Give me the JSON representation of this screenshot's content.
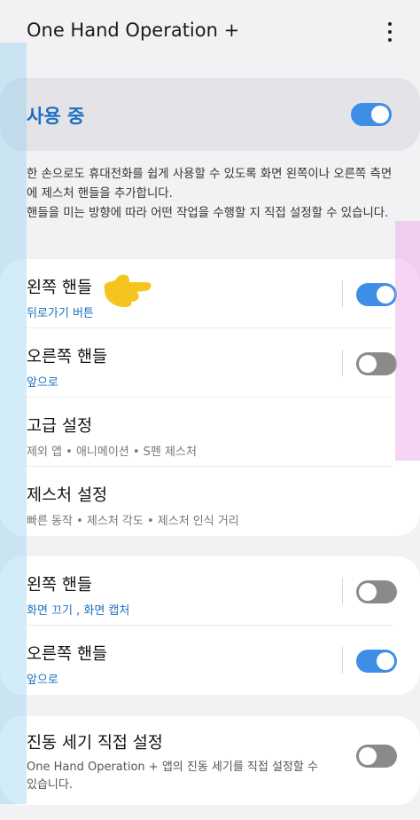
{
  "app_bar": {
    "title": "One Hand Operation +",
    "more_icon": "more-vertical-icon"
  },
  "master": {
    "label": "사용 중",
    "enabled": true
  },
  "description": {
    "line1": "한 손으로도 휴대전화를 쉽게 사용할 수 있도록 화면 왼쪽이나 오른쪽 측면에 제스처 핸들을 추가합니다.",
    "line2": "핸들을 미는 방향에 따라 어떤 작업을 수행할 지 직접 설정할 수 있습니다."
  },
  "section1": {
    "left_handle": {
      "title": "왼쪽 핸들",
      "subtitle": "뒤로가기 버튼",
      "enabled": true
    },
    "right_handle": {
      "title": "오른쪽 핸들",
      "subtitle": "앞으로",
      "enabled": false
    },
    "advanced": {
      "title": "고급 설정",
      "subtitle": "제외 앱 • 애니메이션 • S펜 제스처"
    },
    "gesture": {
      "title": "제스처 설정",
      "subtitle": "빠른 동작 • 제스처 각도 • 제스처 인식 거리"
    }
  },
  "section2": {
    "left_handle": {
      "title": "왼쪽 핸들",
      "subtitle": "화면 끄기 , 화면 캡처",
      "enabled": false
    },
    "right_handle": {
      "title": "오른쪽 핸들",
      "subtitle": "앞으로",
      "enabled": true
    }
  },
  "section3": {
    "vibration": {
      "title": "진동 세기 직접 설정",
      "subtitle_line1": "One Hand Operation + 앱의 진동 세기를 직접 설정할 수",
      "subtitle_line2": "있습니다.",
      "enabled": false
    }
  },
  "colors": {
    "accent": "#1d6fc2",
    "switch_on": "#3e8ee6",
    "switch_off": "#8a8a8a"
  }
}
